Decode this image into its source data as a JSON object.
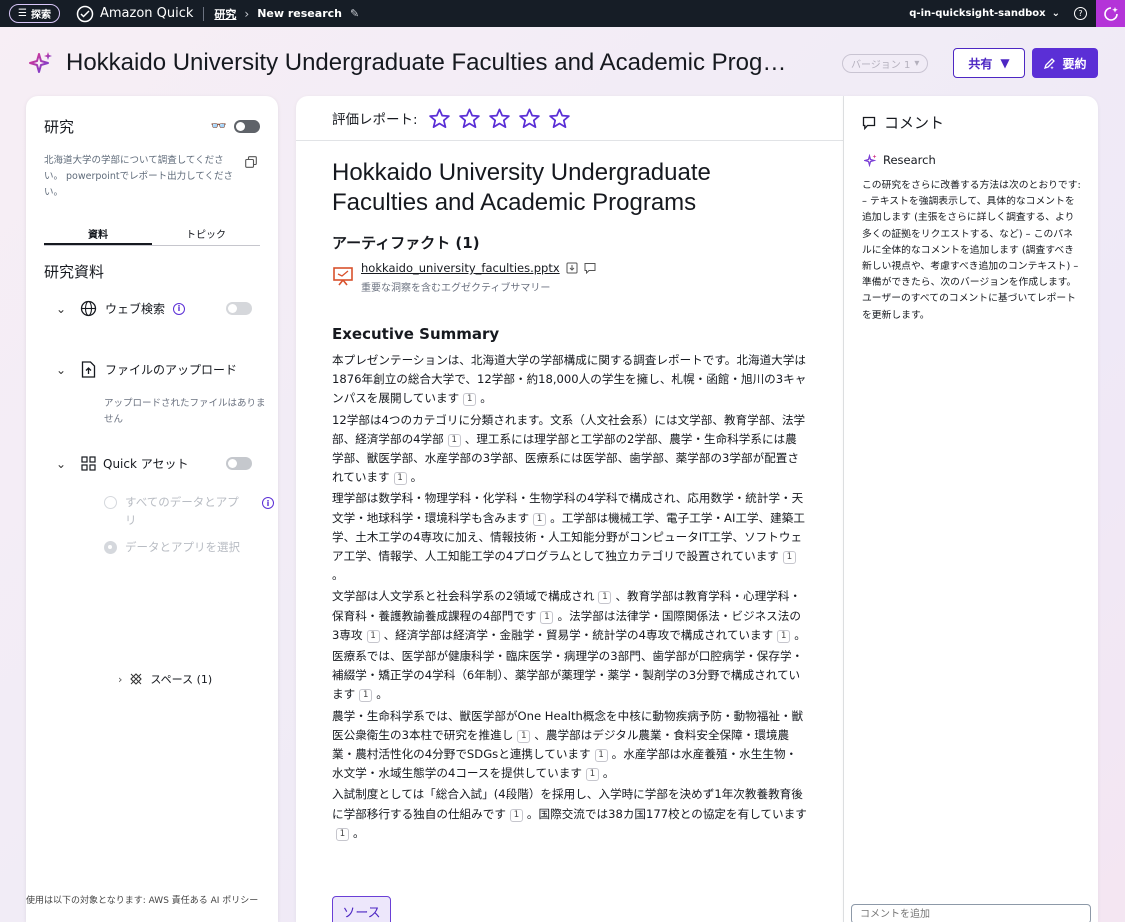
{
  "topbar": {
    "explore_label": "探索",
    "app_name": "Amazon Quick",
    "breadcrumb_research": "研究",
    "current_page": "New research",
    "account": "q-in-quicksight-sandbox"
  },
  "header": {
    "title": "Hokkaido University Undergraduate Faculties and Academic Prog…",
    "version_label": "バージョン 1",
    "share_label": "共有",
    "summary_label": "要約"
  },
  "left_panel": {
    "heading": "研究",
    "prompt": "北海道大学の学部について調査してください。 powerpointでレポート出力してください。",
    "tabs": [
      "資料",
      "トピック"
    ],
    "section_title": "研究資料",
    "web_search_label": "ウェブ検索",
    "file_upload_label": "ファイルのアップロード",
    "no_files_text": "アップロードされたファイルはありません",
    "quick_assets_label": "Quick アセット",
    "all_data_label": "すべてのデータとアプリ",
    "select_data_label": "データとアプリを選択",
    "spaces_label": "スペース (1)",
    "footer_text": "使用は以下の対象となります: ",
    "footer_link": "AWS 責任ある AI ポリシー"
  },
  "center_panel": {
    "rating_label": "評価レポート:",
    "rating_value": 0,
    "rating_max": 5,
    "report_title": "Hokkaido University Undergraduate Faculties and Academic Programs",
    "artifacts_heading": "アーティファクト (1)",
    "artifact_filename": "hokkaido_university_faculties.pptx",
    "artifact_description": "重要な洞察を含むエグゼクティブサマリー",
    "exec_summary_heading": "Executive Summary",
    "paragraphs": {
      "p1a": "本プレゼンテーションは、北海道大学の学部構成に関する調査レポートです。北海道大学は1876年創立の総合大学で、12学部・約18,000人の学生を擁し、札幌・函館・旭川の3キャンパスを展開しています",
      "p1b": "。",
      "p2a": "12学部は4つのカテゴリに分類されます。文系（人文社会系）には文学部、教育学部、法学部、経済学部の4学部",
      "p2b": "、理工系には理学部と工学部の2学部、農学・生命科学系には農学部、獣医学部、水産学部の3学部、医療系には医学部、歯学部、薬学部の3学部が配置されています",
      "p2c": "。",
      "p3a": "理学部は数学科・物理学科・化学科・生物学科の4学科で構成され、応用数学・統計学・天文学・地球科学・環境科学も含みます",
      "p3b": "。工学部は機械工学、電子工学・AI工学、建築工学、土木工学の4専攻に加え、情報技術・人工知能分野がコンピュータIT工学、ソフトウェア工学、情報学、人工知能工学の4プログラムとして独立カテゴリで設置されています",
      "p3c": "。",
      "p4a": "文学部は人文学系と社会科学系の2領域で構成され",
      "p4b": "、教育学部は教育学科・心理学科・保育科・養護教諭養成課程の4部門です",
      "p4c": "。法学部は法律学・国際関係法・ビジネス法の3専攻",
      "p4d": "、経済学部は経済学・金融学・貿易学・統計学の4専攻で構成されています",
      "p4e": "。",
      "p5a": "医療系では、医学部が健康科学・臨床医学・病理学の3部門、歯学部が口腔病学・保存学・補綴学・矯正学の4学科（6年制）、薬学部が薬理学・薬学・製剤学の3分野で構成されています",
      "p5b": "。",
      "p6a": "農学・生命科学系では、獣医学部がOne Health概念を中核に動物疾病予防・動物福祉・獣医公衆衛生の3本柱で研究を推進し",
      "p6b": "、農学部はデジタル農業・食料安全保障・環境農業・農村活性化の4分野でSDGsと連携しています",
      "p6c": "。水産学部は水産養殖・水生生物・水文学・水域生態学の4コースを提供しています",
      "p6d": "。",
      "p7a": "入試制度としては「総合入試」(4段階）を採用し、入学時に学部を決めず1年次教養教育後に学部移行する独自の仕組みです",
      "p7b": "。国際交流では38カ国177校との協定を有しています",
      "p7c": "。"
    },
    "citation": "1",
    "source_button": "ソース"
  },
  "right_panel": {
    "heading": "コメント",
    "research_label": "Research",
    "body": "この研究をさらに改善する方法は次のとおりです: – テキストを強調表示して、具体的なコメントを追加します (主張をさらに詳しく調査する、より多くの証拠をリクエストする、など) – このパネルに全体的なコメントを追加します (調査すべき新しい視点や、考慮すべき追加のコンテキスト) – 準備ができたら、次のバージョンを作成します。ユーザーのすべてのコメントに基づいてレポートを更新します。",
    "comment_placeholder": "コメントを追加"
  },
  "colors": {
    "accent": "#5b2fd6",
    "topbar": "#161d26",
    "star_outline": "#5b2fd6"
  }
}
